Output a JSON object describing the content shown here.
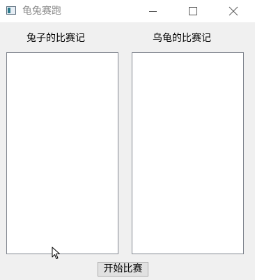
{
  "window": {
    "title": "龟兔赛跑",
    "controls": {
      "minimize_icon": "minimize-icon",
      "maximize_icon": "maximize-icon",
      "close_icon": "close-icon"
    }
  },
  "panels": {
    "rabbit": {
      "label": "兔子的比赛记",
      "entries": []
    },
    "turtle": {
      "label": "乌龟的比赛记",
      "entries": []
    }
  },
  "actions": {
    "start_label": "开始比赛"
  },
  "colors": {
    "window_bg": "#f0f0f0",
    "titlebar_bg": "#ffffff",
    "title_text": "#8a8a8a",
    "list_border": "#828790",
    "button_bg": "#e1e1e1",
    "button_border": "#adadad"
  }
}
